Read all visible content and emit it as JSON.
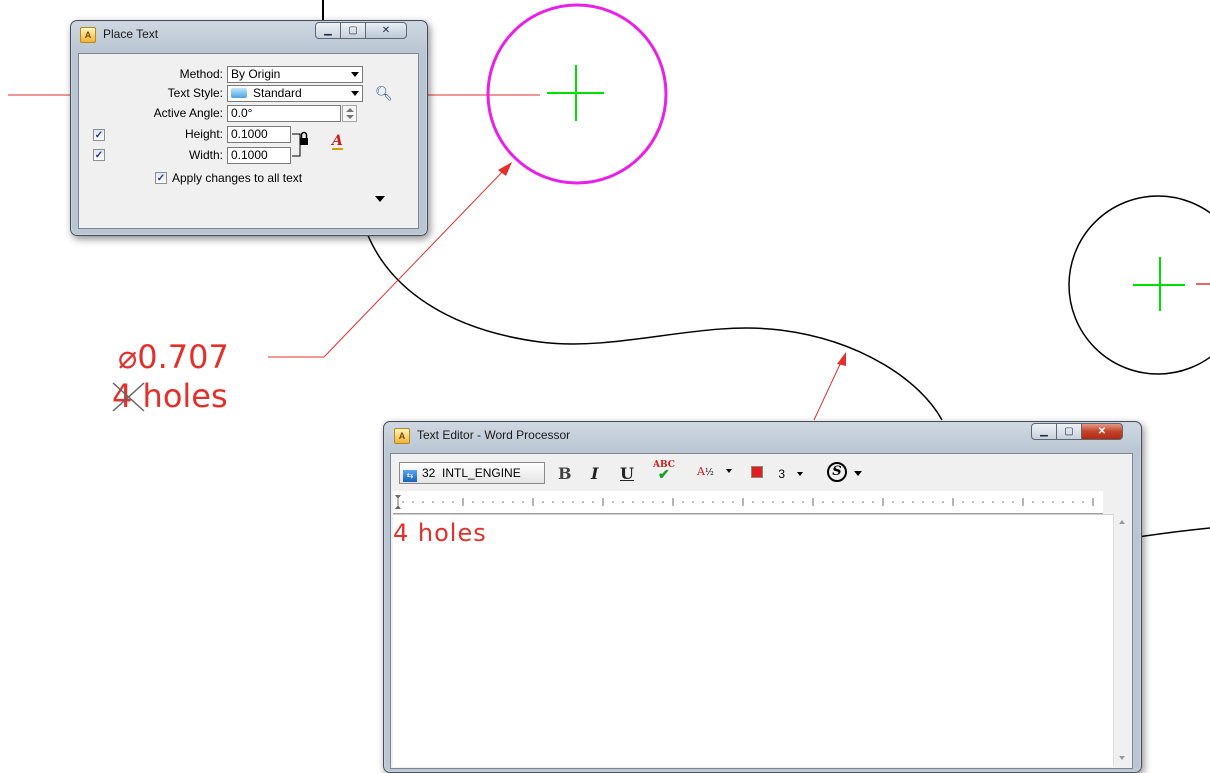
{
  "drawing": {
    "dimension_text": "⌀0.707",
    "holes_text": "4 holes"
  },
  "place_text_dialog": {
    "title": "Place Text",
    "minimize_icon": "minimize-icon",
    "maximize_icon": "maximize-icon",
    "close_icon": "close-icon",
    "method_label": "Method:",
    "method_value": "By Origin",
    "text_style_label": "Text Style:",
    "text_style_value": "Standard",
    "active_angle_label": "Active Angle:",
    "active_angle_value": "0.0°",
    "height_label": "Height:",
    "height_value": "0.1000",
    "height_checked": true,
    "width_label": "Width:",
    "width_value": "0.1000",
    "width_checked": true,
    "apply_all_label": "Apply changes to all text",
    "apply_all_checked": true
  },
  "text_editor": {
    "title": "Text Editor - Word Processor",
    "font_number": "32",
    "font_name": "INTL_ENGINE",
    "bold_label": "B",
    "italic_label": "I",
    "underline_label": "U",
    "spell_label": "ABC",
    "stack_label": "A",
    "color_label": "3",
    "symbol_label": "S",
    "content": "4 holes",
    "text_color": "#e3302b"
  },
  "colors": {
    "magenta": "#e820e8",
    "green": "#00e000",
    "red": "#e3302b"
  }
}
